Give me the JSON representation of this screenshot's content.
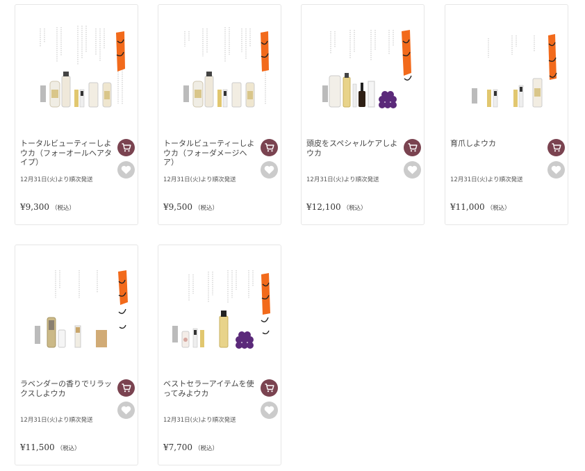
{
  "products": [
    {
      "title": "トータルビューティーしよウカ（フォーオールヘアタイプ）",
      "ship": "12月31日(火)より順次発送",
      "price": "¥9,300",
      "tax": "（税込）",
      "image": "product-set-total-beauty-all-hair"
    },
    {
      "title": "トータルビューティーしよウカ（フォーダメージヘア）",
      "ship": "12月31日(火)より順次発送",
      "price": "¥9,500",
      "tax": "（税込）",
      "image": "product-set-total-beauty-damage-hair"
    },
    {
      "title": "頭皮をスペシャルケアしよウカ",
      "ship": "12月31日(火)より順次発送",
      "price": "¥12,100",
      "tax": "（税込）",
      "image": "product-set-scalp-care"
    },
    {
      "title": "育爪しよウカ",
      "ship": "12月31日(火)より順次発送",
      "price": "¥11,000",
      "tax": "（税込）",
      "image": "product-set-nail-care"
    },
    {
      "title": "ラベンダーの香りでリラックスしよウカ",
      "ship": "12月31日(火)より順次発送",
      "price": "¥11,500",
      "tax": "（税込）",
      "image": "product-set-lavender-relax"
    },
    {
      "title": "ベストセラーアイテムを使ってみよウカ",
      "ship": "12月31日(火)より順次発送",
      "price": "¥7,700",
      "tax": "（税込）",
      "image": "product-set-bestseller"
    }
  ],
  "icons": {
    "cart": "cart-icon",
    "favorite": "heart-icon"
  },
  "colors": {
    "cart_button": "#7a4350",
    "favorite_button": "#cbcbcb",
    "brush_stroke": "#f26a1b",
    "card_border": "#e6e6e6"
  }
}
